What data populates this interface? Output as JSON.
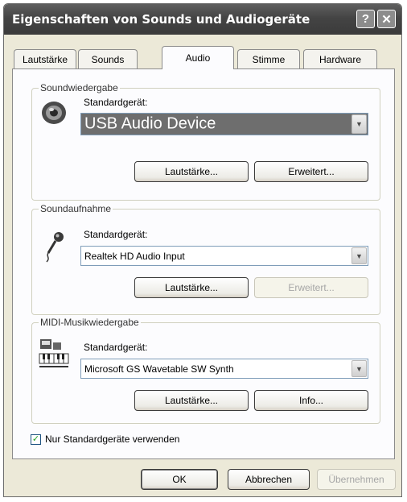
{
  "window": {
    "title": "Eigenschaften von Sounds und Audiogeräte",
    "help_glyph": "?",
    "close_glyph": "✕"
  },
  "tabs": [
    {
      "label": "Lautstärke"
    },
    {
      "label": "Sounds"
    },
    {
      "label": "Audio",
      "active": true
    },
    {
      "label": "Stimme"
    },
    {
      "label": "Hardware"
    }
  ],
  "playback": {
    "legend": "Soundwiedergabe",
    "device_label": "Standardgerät:",
    "device_value": "USB Audio Device",
    "volume_button": "Lautstärke...",
    "advanced_button": "Erweitert..."
  },
  "recording": {
    "legend": "Soundaufnahme",
    "device_label": "Standardgerät:",
    "device_value": "Realtek HD Audio Input",
    "volume_button": "Lautstärke...",
    "advanced_button": "Erweitert..."
  },
  "midi": {
    "legend": "MIDI-Musikwiedergabe",
    "device_label": "Standardgerät:",
    "device_value": "Microsoft GS Wavetable SW Synth",
    "volume_button": "Lautstärke...",
    "info_button": "Info..."
  },
  "default_only": {
    "label": "Nur Standardgeräte verwenden",
    "checked": true,
    "mark": "✓"
  },
  "footer": {
    "ok": "OK",
    "cancel": "Abbrechen",
    "apply": "Übernehmen"
  },
  "icons": {
    "chevron": "▼"
  }
}
